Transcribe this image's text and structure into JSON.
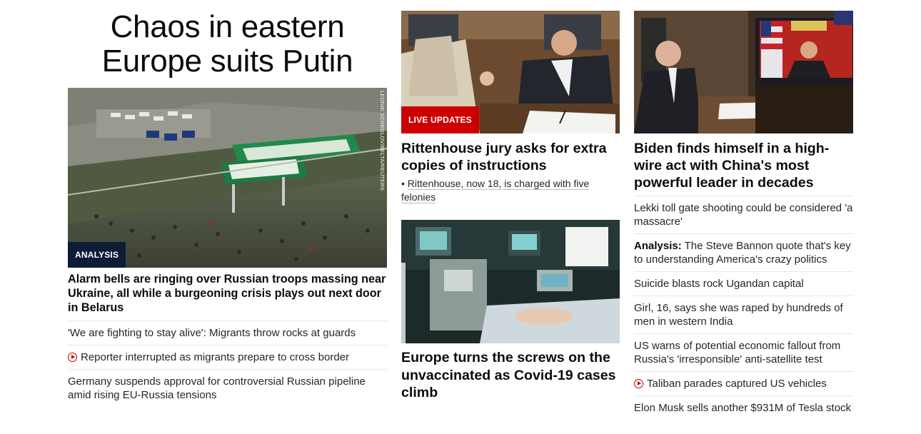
{
  "column1": {
    "hero_title": "Chaos in eastern Europe suits Putin",
    "hero_credit": "LEONID SCHEGLOV/BELTA/REUTERS",
    "hero_tag": "ANALYSIS",
    "hero_subheadline": "Alarm bells are ringing over Russian troops massing near Ukraine, all while a burgeoning crisis plays out next door in Belarus",
    "items": [
      {
        "text": "'We are fighting to stay alive': Migrants throw rocks at guards",
        "video": false
      },
      {
        "text": "Reporter interrupted as migrants prepare to cross border",
        "video": true
      },
      {
        "text": "Germany suspends approval for controversial Russian pipeline amid rising EU-Russia tensions",
        "video": false
      }
    ]
  },
  "column2": {
    "top_tag": "LIVE UPDATES",
    "top_headline": "Rittenhouse jury asks for extra copies of instructions",
    "top_bullet": "Rittenhouse, now 18, is charged with five felonies",
    "bottom_headline": "Europe turns the screws on the unvaccinated as Covid-19 cases climb"
  },
  "column3": {
    "top_headline": "Biden finds himself in a high-wire act with China's most powerful leader in decades",
    "items": [
      {
        "lead": "",
        "text": "Lekki toll gate shooting could be considered 'a massacre'",
        "video": false
      },
      {
        "lead": "Analysis:",
        "text": "The Steve Bannon quote that's key to understanding America's crazy politics",
        "video": false
      },
      {
        "lead": "",
        "text": "Suicide blasts rock Ugandan capital",
        "video": false
      },
      {
        "lead": "",
        "text": "Girl, 16, says she was raped by hundreds of men in western India",
        "video": false
      },
      {
        "lead": "",
        "text": "US warns of potential economic fallout from Russia's 'irresponsible' anti-satellite test",
        "video": false
      },
      {
        "lead": "",
        "text": "Taliban parades captured US vehicles",
        "video": true
      },
      {
        "lead": "",
        "text": "Elon Musk sells another $931M of Tesla stock",
        "video": false
      }
    ]
  },
  "colors": {
    "analysis_tag_bg": "#0c1d35",
    "live_tag_bg": "#cc0000",
    "video_icon": "#cc0000",
    "divider": "#e6e6e6"
  }
}
